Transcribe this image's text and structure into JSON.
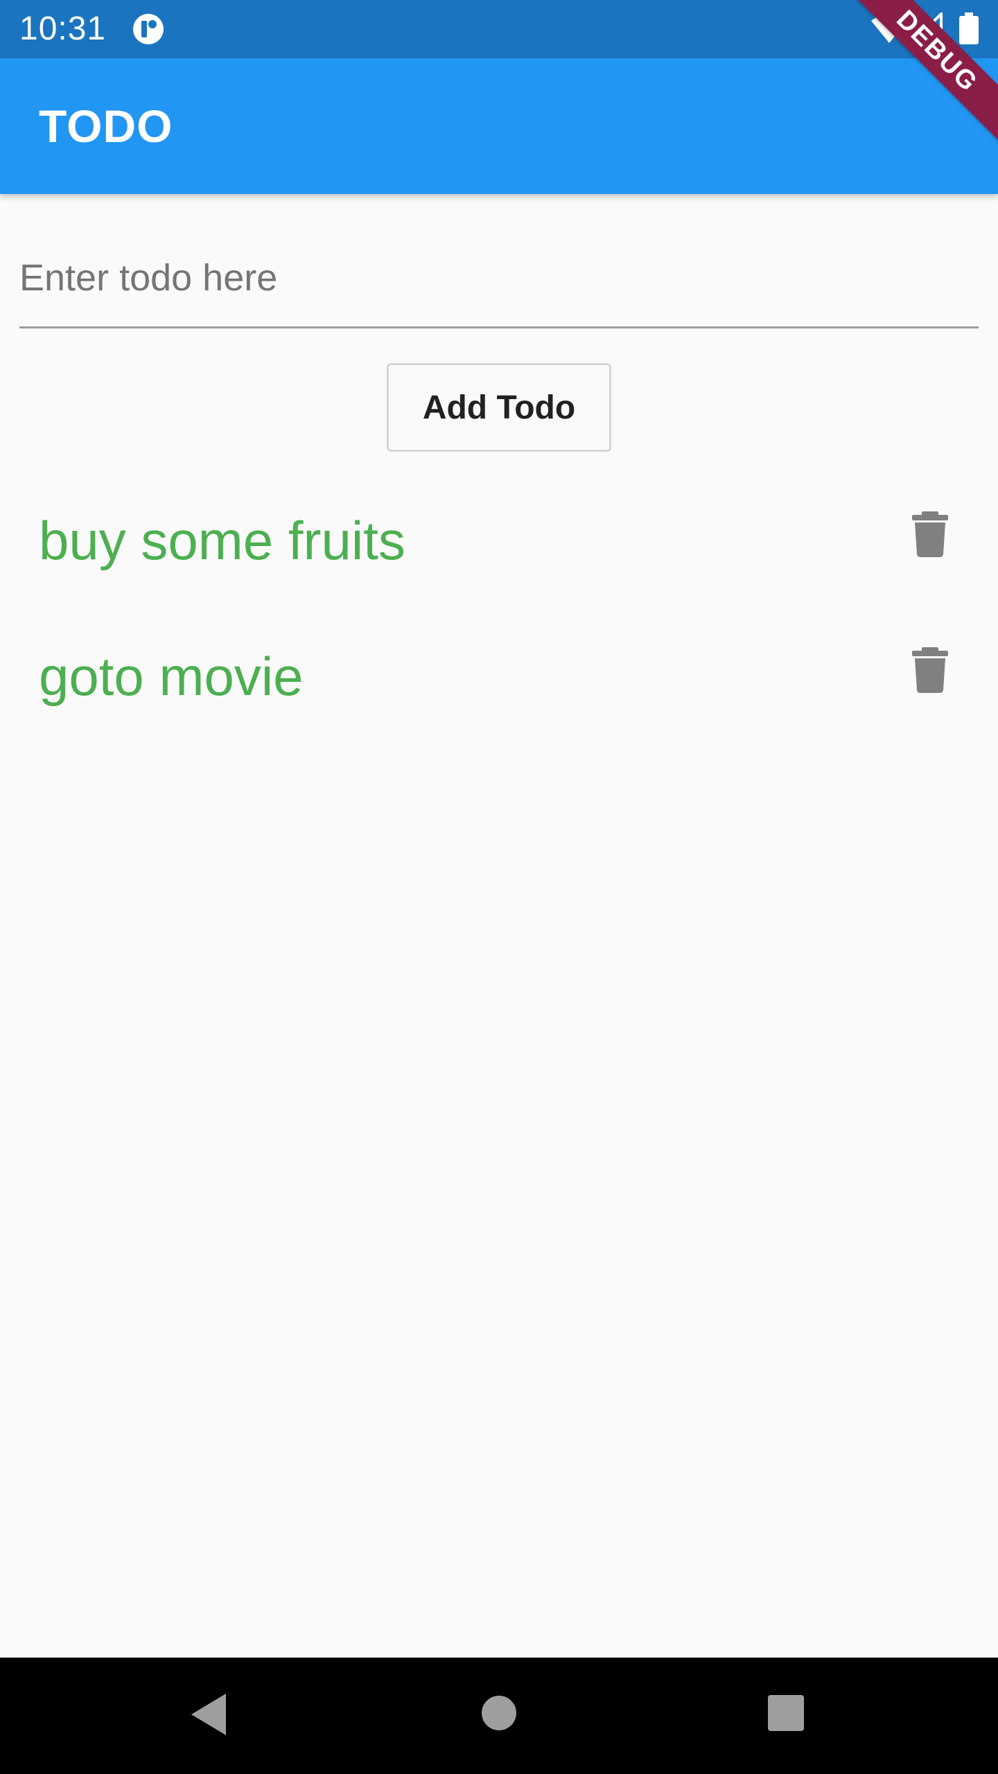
{
  "status_bar": {
    "time": "10:31",
    "icons": [
      "app-notification-icon",
      "wifi-icon",
      "signal-icon",
      "battery-icon"
    ]
  },
  "app_bar": {
    "title": "TODO"
  },
  "debug_banner": {
    "label": "DEBUG"
  },
  "input": {
    "value": "",
    "placeholder": "Enter todo here"
  },
  "add_button": {
    "label": "Add Todo"
  },
  "todos": [
    {
      "text": "buy some fruits",
      "action_icon": "trash-icon"
    },
    {
      "text": "goto movie",
      "action_icon": "trash-icon"
    }
  ],
  "nav_bar": {
    "buttons": [
      "back-icon",
      "home-icon",
      "recents-icon"
    ]
  },
  "colors": {
    "status_bar": "#1b74bf",
    "app_bar": "#2196f3",
    "todo_text": "#4caf50",
    "icon_grey": "#808080",
    "debug_banner": "#8b1e46"
  }
}
